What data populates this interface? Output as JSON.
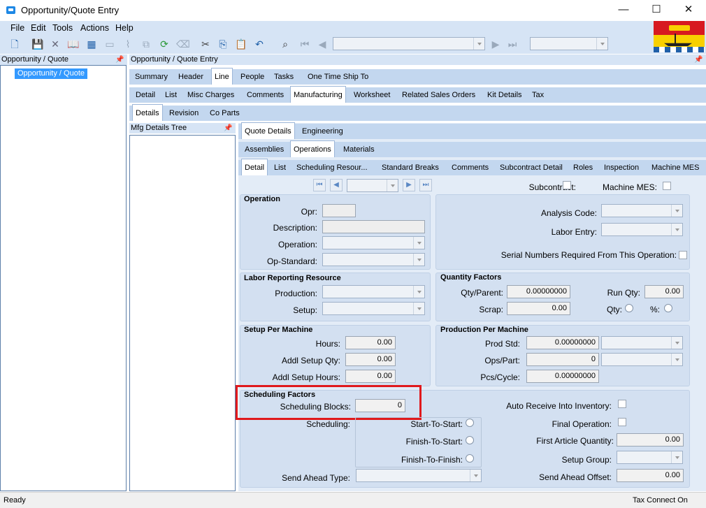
{
  "window": {
    "title": "Opportunity/Quote Entry",
    "minimize": "—",
    "maximize": "☐",
    "close": "✕"
  },
  "menu": [
    "File",
    "Edit",
    "Tools",
    "Actions",
    "Help"
  ],
  "left_pane": {
    "header": "Opportunity / Quote",
    "tree_item": "Opportunity / Quote"
  },
  "main_pane": {
    "header": "Opportunity / Quote Entry"
  },
  "tabs_l1": [
    "Summary",
    "Header",
    "Line",
    "People",
    "Tasks",
    "One Time Ship To"
  ],
  "tabs_l1_selected": "Line",
  "tabs_l2": [
    "Detail",
    "List",
    "Misc Charges",
    "Comments",
    "Manufacturing",
    "Worksheet",
    "Related Sales Orders",
    "Kit Details",
    "Tax"
  ],
  "tabs_l3": [
    "Details",
    "Revision",
    "Co Parts"
  ],
  "mfg_tree": {
    "header": "Mfg Details Tree"
  },
  "tabs_l4": [
    "Quote Details",
    "Engineering"
  ],
  "tabs_l5": [
    "Assemblies",
    "Operations",
    "Materials"
  ],
  "tabs_l6": [
    "Detail",
    "List",
    "Scheduling  Resour...",
    "Standard Breaks",
    "Comments",
    "Subcontract Detail",
    "Roles",
    "Inspection",
    "Machine MES"
  ],
  "top_flags": {
    "subcontract": "Subcontract:",
    "machine_mes": "Machine MES:"
  },
  "operation": {
    "title": "Operation",
    "opr": "Opr:",
    "description": "Description:",
    "operation": "Operation:",
    "op_standard": "Op-Standard:"
  },
  "analysis": {
    "analysis_code": "Analysis Code:",
    "labor_entry": "Labor Entry:",
    "serial_required": "Serial Numbers Required From This Operation:"
  },
  "labor_resource": {
    "title": "Labor Reporting Resource",
    "production": "Production:",
    "setup": "Setup:"
  },
  "quantity_factors": {
    "title": "Quantity Factors",
    "qty_parent_label": "Qty/Parent:",
    "qty_parent": "0.00000000",
    "scrap_label": "Scrap:",
    "scrap": "0.00",
    "run_qty_label": "Run Qty:",
    "run_qty": "0.00",
    "qty_label": "Qty:",
    "pct_label": "%:"
  },
  "setup_machine": {
    "title": "Setup Per Machine",
    "hours_label": "Hours:",
    "hours": "0.00",
    "addl_qty_label": "Addl Setup Qty:",
    "addl_qty": "0.00",
    "addl_hours_label": "Addl Setup Hours:",
    "addl_hours": "0.00"
  },
  "production_machine": {
    "title": "Production Per Machine",
    "prod_std_label": "Prod Std:",
    "prod_std": "0.00000000",
    "ops_part_label": "Ops/Part:",
    "ops_part": "0",
    "pcs_cycle_label": "Pcs/Cycle:",
    "pcs_cycle": "0.00000000"
  },
  "scheduling": {
    "title": "Scheduling Factors",
    "blocks_label": "Scheduling Blocks:",
    "blocks": "0",
    "scheduling_label": "Scheduling:",
    "start_to_start": "Start-To-Start:",
    "finish_to_start": "Finish-To-Start:",
    "finish_to_finish": "Finish-To-Finish:",
    "send_ahead_type": "Send Ahead Type:",
    "auto_receive": "Auto Receive Into Inventory:",
    "final_operation": "Final Operation:",
    "first_article_label": "First Article Quantity:",
    "first_article": "0.00",
    "setup_group": "Setup Group:",
    "send_ahead_offset_label": "Send Ahead Offset:",
    "send_ahead_offset": "0.00"
  },
  "status": {
    "left": "Ready",
    "right": "Tax Connect On"
  },
  "colors": {
    "highlight": "#e0191c",
    "selection": "#3399ff",
    "group": "#d3e0f1"
  }
}
